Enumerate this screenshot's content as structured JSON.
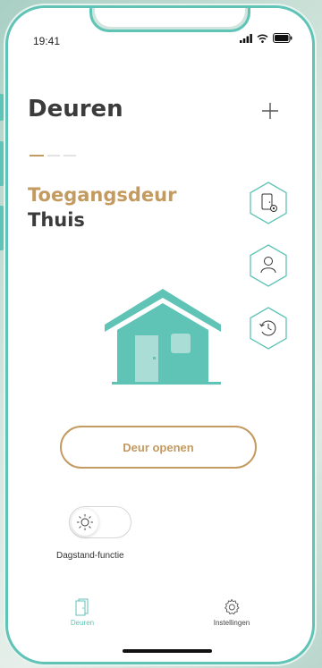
{
  "status_bar": {
    "time": "19:41"
  },
  "header": {
    "title": "Deuren",
    "add_icon": "plus-icon"
  },
  "pager": {
    "count": 3,
    "active": 0
  },
  "door": {
    "name": "Toegangsdeur",
    "location": "Thuis"
  },
  "side_actions": [
    {
      "name": "door-settings",
      "icon": "door-settings-icon"
    },
    {
      "name": "users",
      "icon": "user-icon"
    },
    {
      "name": "history",
      "icon": "history-icon"
    }
  ],
  "open_button": {
    "label": "Deur openen"
  },
  "day_mode": {
    "label": "Dagstand-functie",
    "enabled": false,
    "icon": "sun-icon"
  },
  "tab_bar": {
    "doors": {
      "label": "Deuren",
      "icon": "doors-icon",
      "active": true
    },
    "settings": {
      "label": "Instellingen",
      "icon": "gear-icon",
      "active": false
    }
  },
  "colors": {
    "accent": "#5fc3b6",
    "gold": "#c39a5f",
    "text": "#3b3b3b"
  }
}
